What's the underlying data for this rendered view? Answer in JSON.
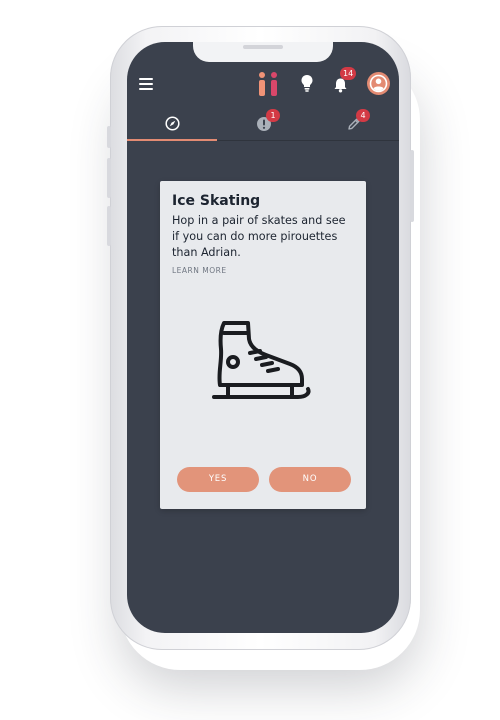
{
  "header": {
    "notification_count": "14"
  },
  "tabs": [
    {
      "name": "explore",
      "icon": "compass-icon",
      "badge": ""
    },
    {
      "name": "alerts",
      "icon": "alert-icon",
      "badge": "1"
    },
    {
      "name": "edit",
      "icon": "pencil-icon",
      "badge": "4"
    }
  ],
  "card": {
    "title": "Ice Skating",
    "description": "Hop in a pair of skates and see if you can do more pirouettes than Adrian.",
    "learn_more": "LEARN MORE",
    "yes_label": "YES",
    "no_label": "NO",
    "illustration": "ice-skate-icon"
  },
  "colors": {
    "screen_bg": "#3b414d",
    "accent": "#e38b73",
    "button": "#e2947a",
    "badge": "#d33a45",
    "card_bg": "#e8eaed"
  }
}
